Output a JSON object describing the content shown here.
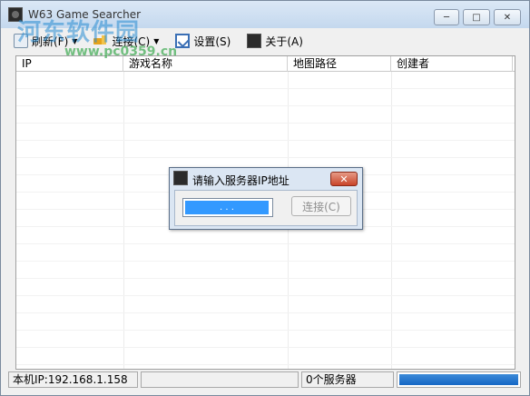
{
  "window": {
    "title": "W63 Game Searcher",
    "minimize": "─",
    "maximize": "□",
    "close": "✕"
  },
  "watermark": {
    "text": "河东软件园",
    "url": "www.pc0359.cn"
  },
  "toolbar": {
    "items": [
      {
        "label": "刷新(F)",
        "icon": "refresh-icon",
        "has_dropdown": true
      },
      {
        "label": "连接(C)",
        "icon": "connect-icon",
        "has_dropdown": true
      },
      {
        "label": "设置(S)",
        "icon": "settings-icon",
        "has_dropdown": false
      },
      {
        "label": "关于(A)",
        "icon": "about-icon",
        "has_dropdown": false
      }
    ],
    "dropdown_arrow": "▼"
  },
  "list": {
    "columns": [
      "IP",
      "游戏名称",
      "地图路径",
      "创建者"
    ],
    "rows": []
  },
  "statusbar": {
    "local_ip": "本机IP:192.168.1.158",
    "middle": "",
    "server_count": "0个服务器",
    "progress": 1.0
  },
  "dialog": {
    "title": "请输入服务器IP地址",
    "close": "✕",
    "ip_value": ".      .      .",
    "connect_label": "连接(C)"
  },
  "colors": {
    "titlebar": "#c4d8ee",
    "progress": "#1566c4",
    "dialog_close": "#c94429",
    "selection": "#3399ff"
  }
}
